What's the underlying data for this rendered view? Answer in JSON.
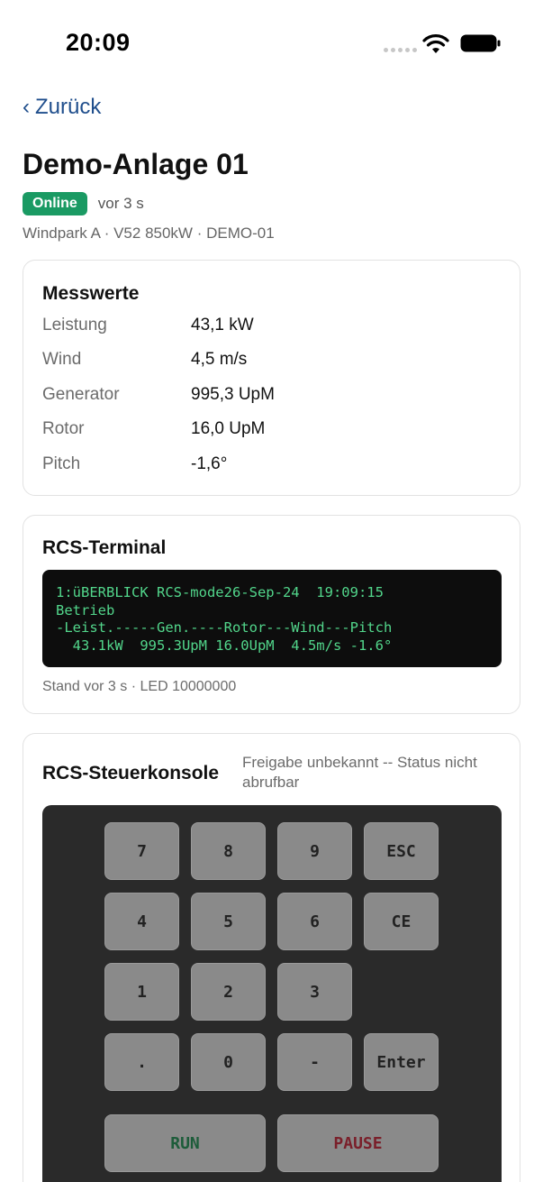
{
  "status_bar": {
    "time": "20:09"
  },
  "nav": {
    "back_label": "Zurück",
    "back_chevron": "‹"
  },
  "header": {
    "title": "Demo-Anlage 01",
    "status_badge": "Online",
    "status_color": "#1a9a63",
    "age": "vor 3 s",
    "subtitle": "Windpark A · V52 850kW · DEMO-01"
  },
  "measurements": {
    "title": "Messwerte",
    "rows": [
      {
        "label": "Leistung",
        "value": "43,1 kW"
      },
      {
        "label": "Wind",
        "value": "4,5 m/s"
      },
      {
        "label": "Generator",
        "value": "995,3 UpM"
      },
      {
        "label": "Rotor",
        "value": "16,0 UpM"
      },
      {
        "label": "Pitch",
        "value": "-1,6°"
      }
    ]
  },
  "terminal": {
    "title": "RCS-Terminal",
    "lines": [
      "1:üBERBLICK RCS-mode26-Sep-24  19:09:15",
      "Betrieb",
      "-Leist.-----Gen.----Rotor---Wind---Pitch",
      "  43.1kW  995.3UpM 16.0UpM  4.5m/s -1.6°"
    ],
    "footer": "Stand vor 3 s · LED 10000000",
    "text_color": "#52d68b"
  },
  "console": {
    "title": "RCS-Steuerkonsole",
    "status": "Freigabe unbekannt -- Status nicht abrufbar",
    "keys": {
      "k7": "7",
      "k8": "8",
      "k9": "9",
      "esc": "ESC",
      "k4": "4",
      "k5": "5",
      "k6": "6",
      "ce": "CE",
      "k1": "1",
      "k2": "2",
      "k3": "3",
      "dot": ".",
      "k0": "0",
      "minus": "-",
      "enter": "Enter",
      "run": "RUN",
      "pause": "PAUSE"
    }
  }
}
